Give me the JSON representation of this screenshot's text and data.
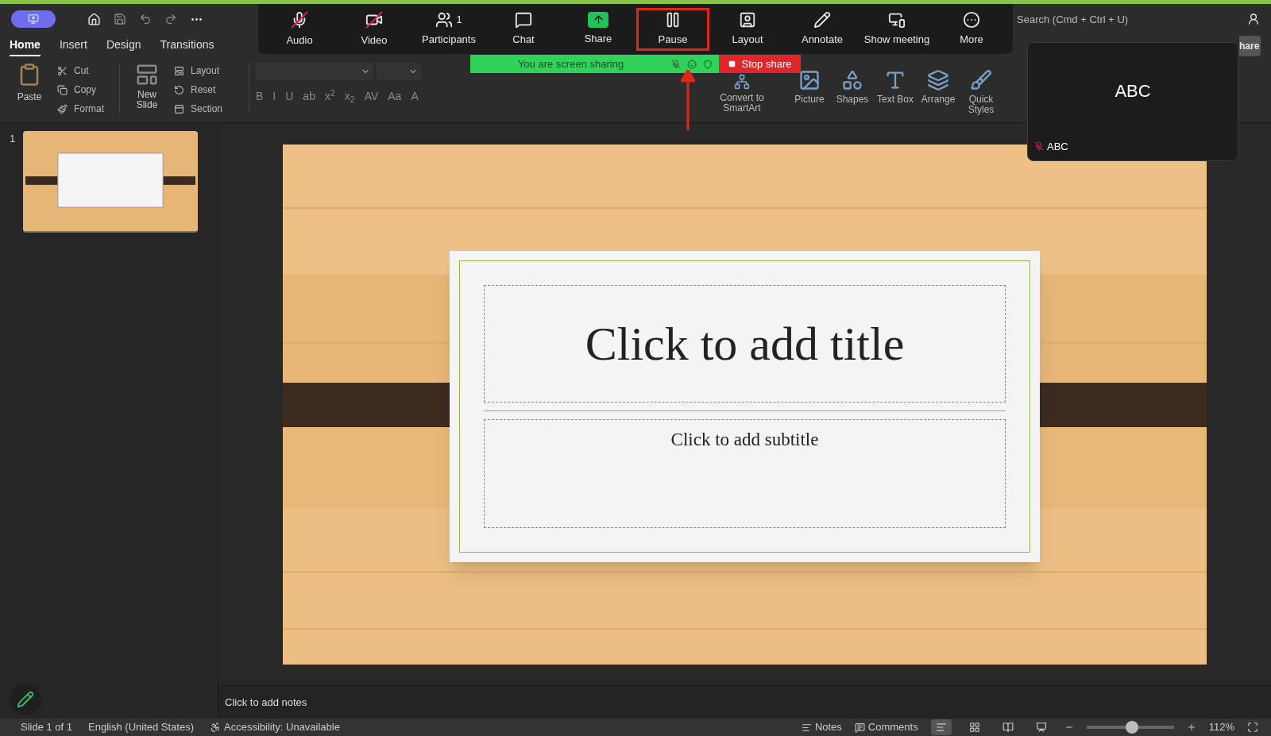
{
  "ribbon_tabs": [
    {
      "label": "Home",
      "selected": true
    },
    {
      "label": "Insert",
      "selected": false
    },
    {
      "label": "Design",
      "selected": false
    },
    {
      "label": "Transitions",
      "selected": false
    }
  ],
  "clipboard": {
    "paste": "Paste",
    "items": [
      {
        "kind": "cut",
        "label": "Cut"
      },
      {
        "kind": "copy",
        "label": "Copy"
      },
      {
        "kind": "format",
        "label": "Format"
      }
    ]
  },
  "slides_group": {
    "new_slide": "New Slide",
    "items": [
      {
        "kind": "layout",
        "label": "Layout"
      },
      {
        "kind": "reset",
        "label": "Reset"
      },
      {
        "kind": "section",
        "label": "Section"
      }
    ]
  },
  "font_buttons": [
    "B",
    "I",
    "U",
    "ab",
    "x$^{2}$",
    "x$_{2}$",
    "AV",
    "Aa",
    "A"
  ],
  "insert_buttons": [
    {
      "kind": "smartart",
      "label": "Convert to SmartArt"
    },
    {
      "kind": "picture",
      "label": "Picture"
    },
    {
      "kind": "shapes",
      "label": "Shapes"
    },
    {
      "kind": "textbox",
      "label": "Text Box"
    },
    {
      "kind": "arrange",
      "label": "Arrange"
    },
    {
      "kind": "styles",
      "label": "Quick Styles"
    }
  ],
  "search": {
    "placeholder": "Search (Cmd + Ctrl + U)"
  },
  "share_button": "hare",
  "meeting_toolbar": [
    {
      "kind": "audio",
      "label": "Audio",
      "muted": true,
      "highlighted": false
    },
    {
      "kind": "video",
      "label": "Video",
      "muted": true,
      "highlighted": false
    },
    {
      "kind": "participants",
      "label": "Participants",
      "count": "1",
      "highlighted": false
    },
    {
      "kind": "chat",
      "label": "Chat",
      "highlighted": false
    },
    {
      "kind": "share",
      "label": "Share",
      "highlighted": false
    },
    {
      "kind": "pause",
      "label": "Pause",
      "highlighted": true
    },
    {
      "kind": "layout",
      "label": "Layout",
      "highlighted": false
    },
    {
      "kind": "annotate",
      "label": "Annotate",
      "highlighted": false
    },
    {
      "kind": "show",
      "label": "Show meeting",
      "highlighted": false
    },
    {
      "kind": "more",
      "label": "More",
      "highlighted": false
    }
  ],
  "sharing_bar": {
    "status": "You are screen sharing",
    "stop": "Stop share"
  },
  "video_tile": {
    "name_large": "ABC",
    "name": "ABC",
    "muted": true
  },
  "slides_panel": [
    {
      "number": "1",
      "selected": true
    }
  ],
  "slide": {
    "title": "Click to add title",
    "subtitle": "Click to add subtitle"
  },
  "notes": {
    "placeholder": "Click to add notes"
  },
  "status_bar": {
    "slide": "Slide 1 of 1",
    "language": "English (United States)",
    "accessibility": "Accessibility: Unavailable",
    "notes": "Notes",
    "comments": "Comments",
    "views": [
      {
        "kind": "normal",
        "selected": true
      },
      {
        "kind": "sorter",
        "selected": false
      },
      {
        "kind": "reading",
        "selected": false
      },
      {
        "kind": "show",
        "selected": false
      }
    ],
    "zoom": {
      "level": 0.52
    },
    "zoom_reading": "112%"
  }
}
